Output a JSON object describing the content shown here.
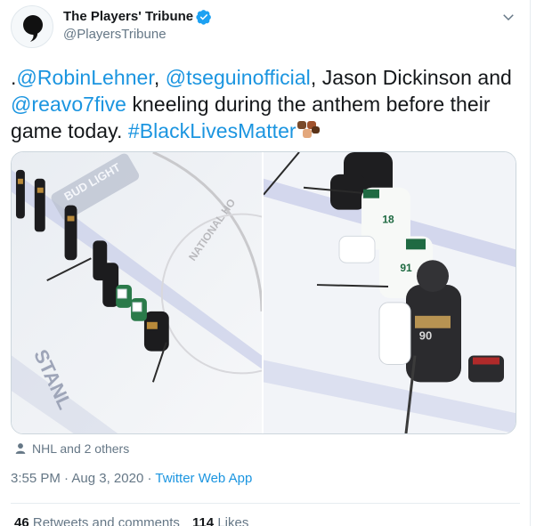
{
  "author": {
    "display_name": "The Players' Tribune",
    "handle": "@PlayersTribune",
    "verified": true,
    "avatar_icon": "quote-mark-icon"
  },
  "tweet": {
    "parts": [
      {
        "type": "text",
        "value": "."
      },
      {
        "type": "mention",
        "value": "@RobinLehner"
      },
      {
        "type": "text",
        "value": ", "
      },
      {
        "type": "mention",
        "value": "@tseguinofficial"
      },
      {
        "type": "text",
        "value": ", Jason Dickinson and "
      },
      {
        "type": "mention",
        "value": "@reavo7five"
      },
      {
        "type": "text",
        "value": " kneeling during the anthem before their game today. "
      },
      {
        "type": "hashtag",
        "value": "#BlackLivesMatter"
      }
    ],
    "emoji": "raised-fists-emoji"
  },
  "media": {
    "photos": [
      {
        "name": "photo-players-on-ice",
        "rink_text": [
          "BUD LIGHT",
          "NATIONAL HO",
          "STANL"
        ]
      },
      {
        "name": "photo-players-kneeling",
        "jersey_numbers": [
          "18",
          "91",
          "90"
        ]
      }
    ]
  },
  "tagged": {
    "icon": "person-icon",
    "text": "NHL and 2 others"
  },
  "meta": {
    "time": "3:55 PM",
    "separator": " · ",
    "date": "Aug 3, 2020",
    "source": "Twitter Web App"
  },
  "stats": {
    "retweets_count": "46",
    "retweets_label": "Retweets and comments",
    "likes_count": "114",
    "likes_label": "Likes"
  },
  "colors": {
    "link": "#1b95e0",
    "secondary_text": "#657786",
    "verified_badge": "#1da1f2"
  }
}
